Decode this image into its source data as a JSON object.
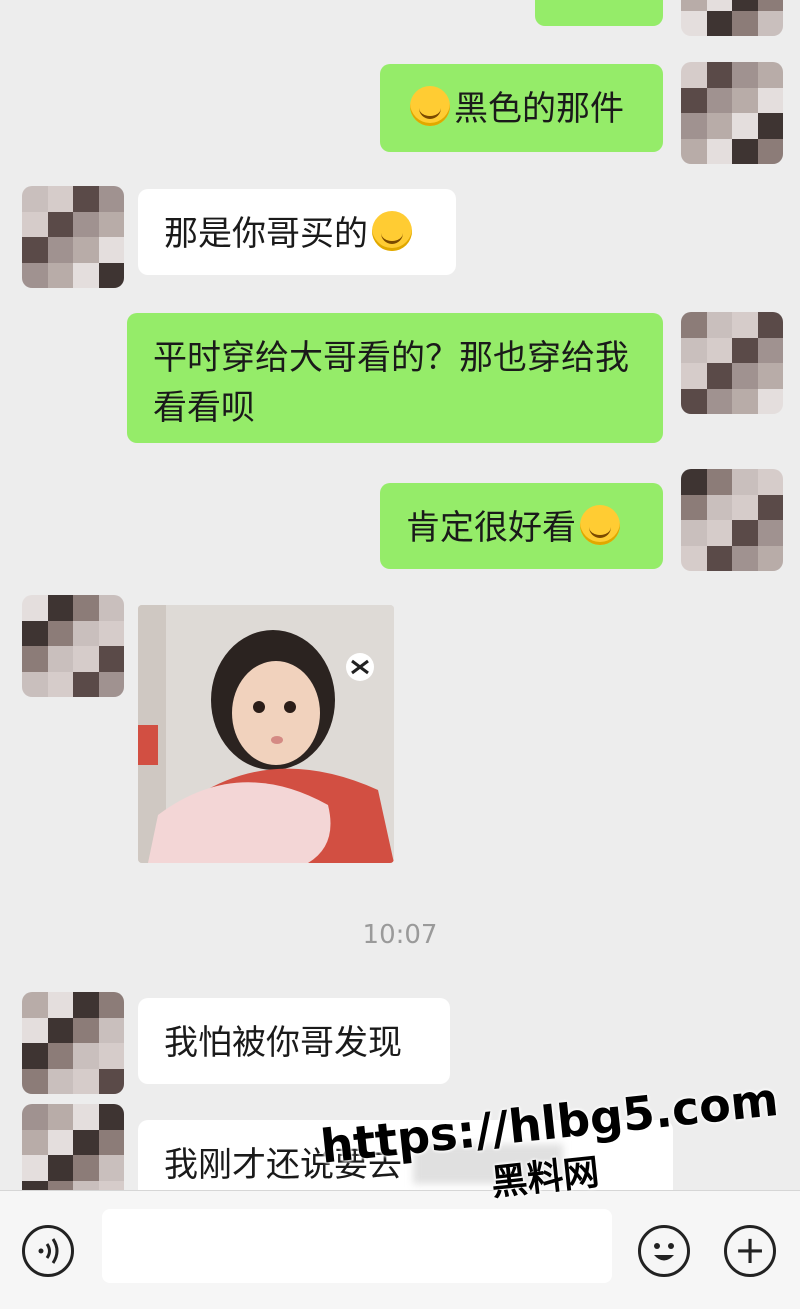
{
  "messages": [
    {
      "side": "out",
      "text": "黑色的那件",
      "emoji": "smiling-emoji"
    },
    {
      "side": "in",
      "text": "那是你哥买的",
      "emoji": "sweat-emoji"
    },
    {
      "side": "out",
      "text": "平时穿给大哥看的？那也穿给我看看呗"
    },
    {
      "side": "out",
      "text": "肯定很好看",
      "emoji": "grin-emoji"
    },
    {
      "side": "in",
      "type": "image"
    },
    {
      "side": "in",
      "text": "我怕被你哥发现"
    },
    {
      "side": "in",
      "text": "我刚才还说要去"
    }
  ],
  "timestamp": "10:07",
  "watermark": {
    "url": "https://hlbg5.com",
    "name": "黑料网"
  },
  "input_bar": {
    "voice_icon": "voice-icon",
    "emoji_icon": "emoji-icon",
    "plus_icon": "plus-icon",
    "plus_glyph": "+"
  },
  "colors": {
    "outgoing": "#95ec69",
    "incoming": "#ffffff",
    "background": "#ededed"
  }
}
